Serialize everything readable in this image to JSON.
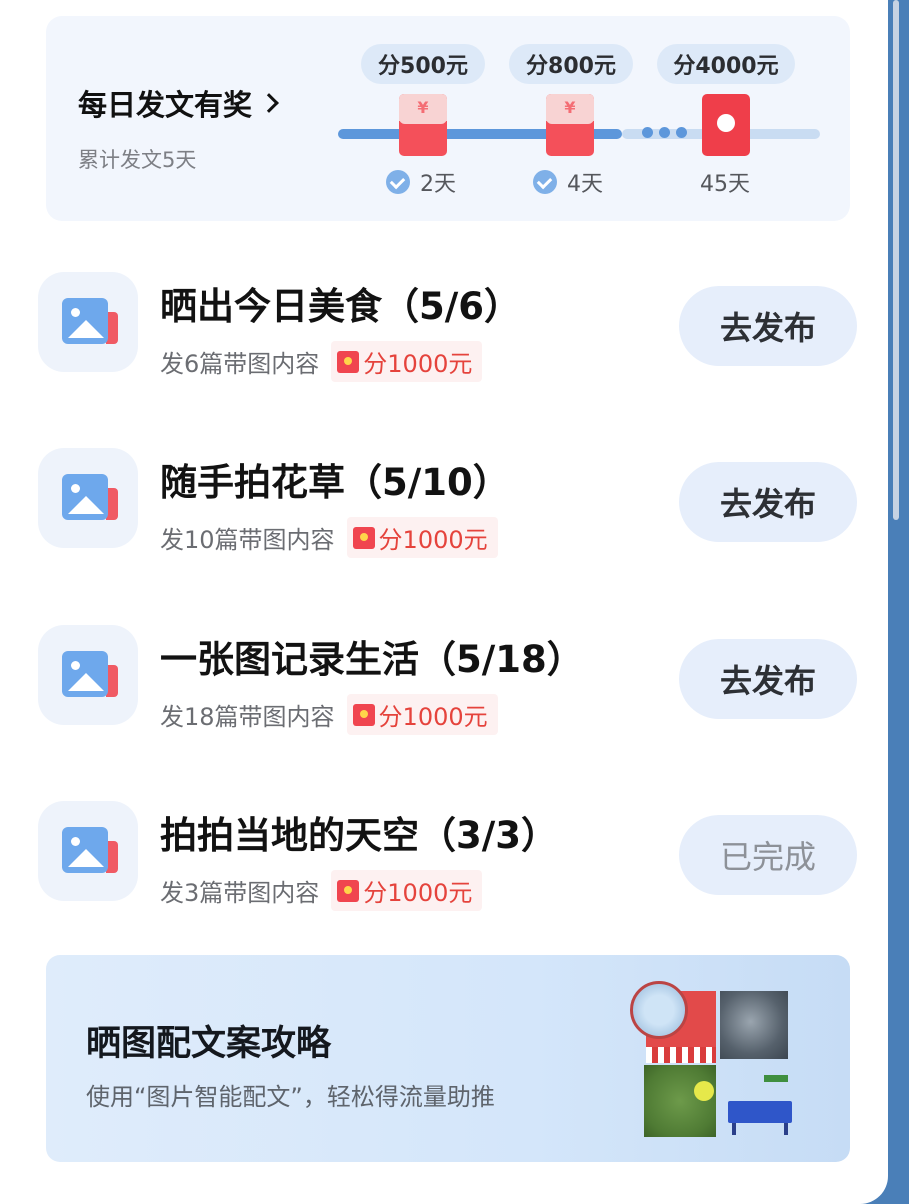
{
  "daily": {
    "title": "每日发文有奖",
    "subtitle": "累计发文5天",
    "milestones": [
      {
        "reward": "分500元",
        "day": "2天",
        "done": true
      },
      {
        "reward": "分800元",
        "day": "4天",
        "done": true
      },
      {
        "reward": "分4000元",
        "day": "45天",
        "done": false
      }
    ],
    "envelope_symbol": "¥"
  },
  "tasks": [
    {
      "title": "晒出今日美食（5/6）",
      "desc": "发6篇带图内容",
      "reward": "分1000元",
      "button": "去发布"
    },
    {
      "title": "随手拍花草（5/10）",
      "desc": "发10篇带图内容",
      "reward": "分1000元",
      "button": "去发布"
    },
    {
      "title": "一张图记录生活（5/18）",
      "desc": "发18篇带图内容",
      "reward": "分1000元",
      "button": "去发布"
    },
    {
      "title": "拍拍当地的天空（3/3）",
      "desc": "发3篇带图内容",
      "reward": "分1000元",
      "button": "已完成"
    }
  ],
  "guide": {
    "title": "晒图配文案攻略",
    "subtitle": "使用“图片智能配文”，轻松得流量助推"
  },
  "colors": {
    "accent_blue": "#5d97db",
    "reward_red": "#e5433c",
    "envelope_red": "#f4505a",
    "button_bg": "#e6eefb"
  },
  "icons": {
    "task_icon": "image-icon",
    "reward_icon": "red-envelope-icon",
    "check_icon": "check-circle-icon"
  }
}
